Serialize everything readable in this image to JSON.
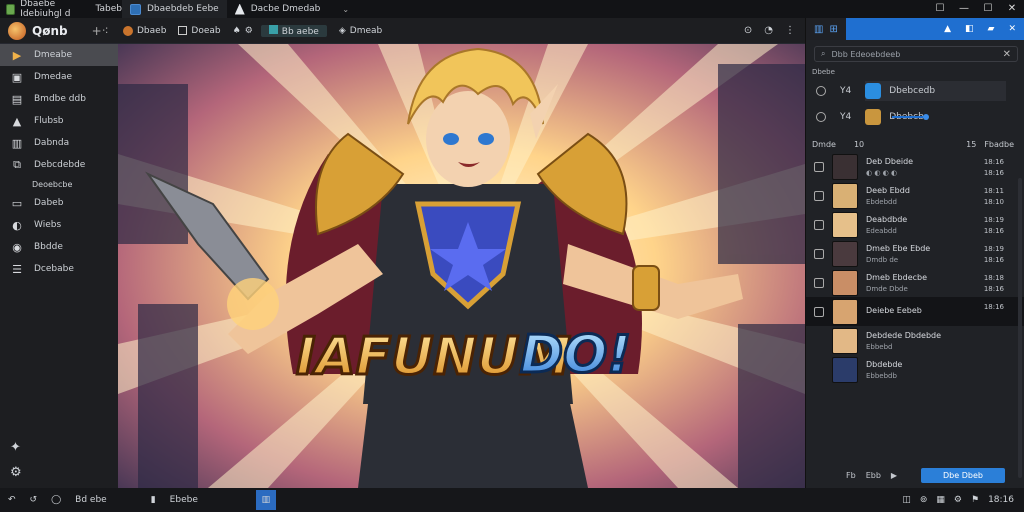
{
  "titlebar": {
    "app_name": "Dbaebe Idebiuhgl d",
    "extra": "Tabeb",
    "tabs": [
      {
        "label": "Dbaebdeb Eebe"
      },
      {
        "label": "Dacbe Dmedab"
      }
    ],
    "window_controls": [
      "☐",
      "—",
      "☐",
      "✕"
    ]
  },
  "header": {
    "brand": "Qønb",
    "items": [
      {
        "label": "Dbaeb"
      },
      {
        "label": "Doeab"
      },
      {
        "label": "Bb aebe"
      },
      {
        "label": "Dmeab"
      }
    ],
    "right_icons": [
      "⊙",
      "◔",
      "⋮"
    ]
  },
  "sidebar": {
    "items": [
      {
        "label": "Dmeabe",
        "icon": "folder-icon",
        "glyph": "▶",
        "active": true
      },
      {
        "label": "Dmedae",
        "icon": "image-icon",
        "glyph": "▣"
      },
      {
        "label": "Bmdbe ddb",
        "icon": "window-icon",
        "glyph": "▤"
      },
      {
        "label": "Flubsb",
        "icon": "image-icon",
        "glyph": "▲"
      },
      {
        "label": "Dabnda",
        "icon": "document-icon",
        "glyph": "▥"
      },
      {
        "label": "Debcdebde",
        "icon": "layers-icon",
        "glyph": "⧉"
      },
      {
        "label": "Deoebcbe",
        "icon": "",
        "glyph": "",
        "sub": true
      },
      {
        "label": "Dabeb",
        "icon": "monitor-icon",
        "glyph": "▭"
      },
      {
        "label": "Wiebs",
        "icon": "drop-icon",
        "glyph": "◐"
      },
      {
        "label": "Bbdde",
        "icon": "circle-icon",
        "glyph": "◉"
      },
      {
        "label": "Dcebabe",
        "icon": "list-icon",
        "glyph": "☰"
      }
    ],
    "bottom_icons": [
      "✦",
      "⚙"
    ]
  },
  "canvas": {
    "headline_left": "IAFUNUM",
    "headline_right": "DO!",
    "colors": {
      "ray": "#ffe9b8",
      "gold": "#d8a036",
      "hair": "#f1c55a",
      "cape": "#6b1d2c",
      "shirt": "#2b2e36",
      "gem": "#3a4bbf"
    }
  },
  "panel": {
    "top_labels": [
      "▥",
      "⊞"
    ],
    "tab_icons": [
      "▲",
      "◧",
      "▰",
      "✕"
    ],
    "search_placeholder": "Dbb Edeoebdeeb",
    "section_label": "Dbebe",
    "header_rows": [
      {
        "prefix": "Y4",
        "label": "Dbebcedb",
        "selected": true
      },
      {
        "prefix": "Y4",
        "label": "Dbebcb"
      }
    ],
    "list_head": {
      "left": "Dmde",
      "mid": "10",
      "right_num": "15",
      "right_label": "Fbadbe"
    },
    "rows": [
      {
        "title": "Deb Dbeide",
        "sub": "◐ ◐ ◐ ◐",
        "meta1": "18:16",
        "meta2": "18:16",
        "avatar": "#3a3033"
      },
      {
        "title": "Deeb Ebdd",
        "sub": "Ebdebdd",
        "meta1": "18:11",
        "meta2": "18:10",
        "avatar": "#d9b074"
      },
      {
        "title": "Deabdbde",
        "sub": "Edeabdd",
        "meta1": "18:19",
        "meta2": "18:16",
        "avatar": "#e6c08a"
      },
      {
        "title": "Dmeb Ebe Ebde",
        "sub": "Dmdb de",
        "meta1": "18:19",
        "meta2": "18:16",
        "avatar": "#4a3a3e"
      },
      {
        "title": "Dmeb Ebdecbe",
        "sub": "Dmde Dbde",
        "meta1": "18:18",
        "meta2": "18:16",
        "avatar": "#c98e66"
      },
      {
        "title": "Deiebe Eebeb",
        "sub": "",
        "meta1": "18:16",
        "meta2": "",
        "avatar": "#d7a470",
        "selected": true
      },
      {
        "title": "Debdede Dbdebde",
        "sub": "Ebbebd",
        "meta1": "",
        "meta2": "",
        "avatar": "#e2b886"
      },
      {
        "title": "Dbdebde",
        "sub": "Ebbebdb",
        "meta1": "",
        "meta2": "",
        "avatar": "#2b3c6a"
      }
    ],
    "footer": {
      "a": "Fb",
      "b": "Ebb",
      "arrow": "▶",
      "button": "Dbe Dbeb"
    }
  },
  "statusbar": {
    "left_icons": [
      "↶",
      "↺",
      "◯"
    ],
    "left_text": "Bd ebe",
    "doc_label": "Ebebe",
    "right_text": "18:16"
  }
}
